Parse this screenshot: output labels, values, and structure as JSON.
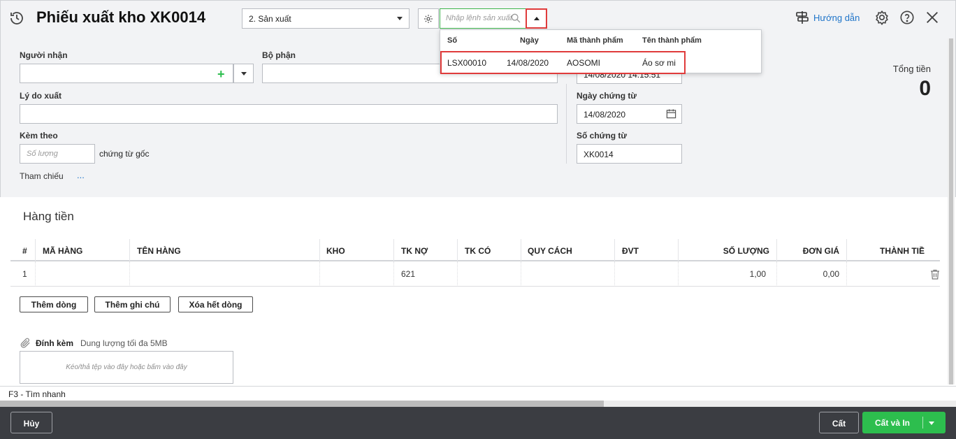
{
  "header": {
    "title": "Phiếu xuất kho XK0014",
    "type_select": "2. Sản xuất",
    "lookup_placeholder": "Nhập lệnh sản xuất",
    "help_label": "Hướng dẫn"
  },
  "popup": {
    "columns": [
      "Số",
      "Ngày",
      "Mã thành phẩm",
      "Tên thành phẩm"
    ],
    "rows": [
      {
        "so": "LSX00010",
        "ngay": "14/08/2020",
        "ma": "AOSOMI",
        "ten": "Áo sơ mi"
      }
    ]
  },
  "form": {
    "nguoi_nhan_label": "Người nhận",
    "bo_phan_label": "Bộ phận",
    "ly_do_label": "Lý do xuất",
    "kem_theo_label": "Kèm theo",
    "so_luong_placeholder": "Số lượng",
    "chung_tu_goc": "chứng từ gốc",
    "tham_chieu": "Tham chiếu",
    "tham_chieu_more": "...",
    "hach_toan_value": "14/08/2020 14:15:51",
    "ngay_chung_tu_label": "Ngày chứng từ",
    "ngay_chung_tu_value": "14/08/2020",
    "so_chung_tu_label": "Số chứng từ",
    "so_chung_tu_value": "XK0014",
    "tong_tien_label": "Tổng tiền",
    "tong_tien_value": "0"
  },
  "grid": {
    "section_title": "Hàng tiền",
    "columns": [
      "#",
      "MÃ HÀNG",
      "TÊN HÀNG",
      "KHO",
      "TK NỢ",
      "TK CÓ",
      "QUY CÁCH",
      "ĐVT",
      "SỐ LƯỢNG",
      "ĐƠN GIÁ",
      "THÀNH TIỀ"
    ],
    "rows": [
      {
        "no": "1",
        "ma": "",
        "ten": "",
        "kho": "",
        "tk_no": "621",
        "tk_co": "",
        "quy_cach": "",
        "dvt": "",
        "so_luong": "1,00",
        "don_gia": "0,00",
        "thanh_tien": ""
      }
    ],
    "buttons": {
      "add_row": "Thêm dòng",
      "add_note": "Thêm ghi chú",
      "delete_all": "Xóa hết dòng"
    }
  },
  "attach": {
    "title": "Đính kèm",
    "limit": "Dung lượng tối đa 5MB",
    "dropzone": "Kéo/thả tệp vào đây hoặc bấm vào đây"
  },
  "status": {
    "text": "F3 - Tìm nhanh"
  },
  "footer": {
    "cancel": "Hủy",
    "save": "Cất",
    "save_print": "Cất và In"
  },
  "colors": {
    "accent_green": "#2dbe4e",
    "highlight_red": "#e03b3b",
    "link_blue": "#1e74c9",
    "footer_bg": "#3b3d42"
  }
}
